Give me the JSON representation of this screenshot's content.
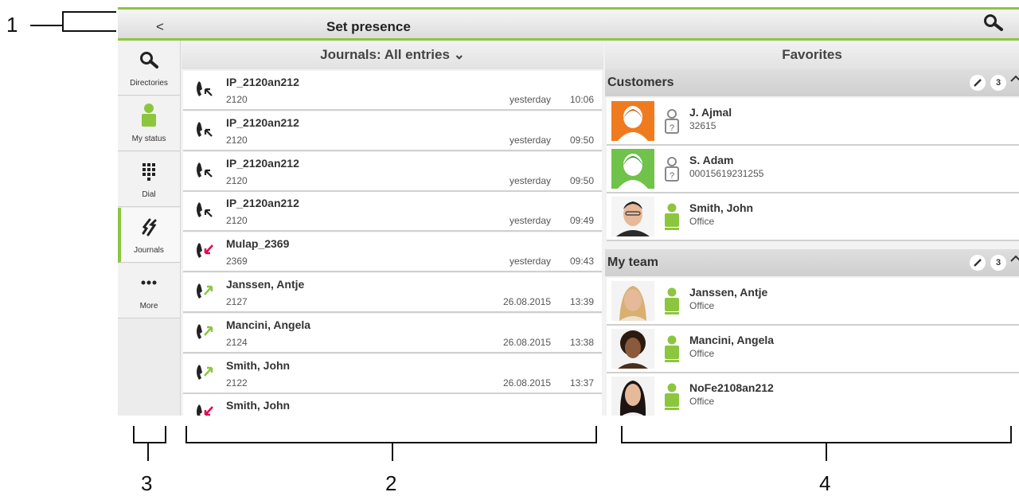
{
  "callouts": [
    "1",
    "2",
    "3",
    "4"
  ],
  "topbar": {
    "back_label": "<",
    "title": "Set presence"
  },
  "nav": [
    {
      "label": "Directories",
      "icon": "search-icon"
    },
    {
      "label": "My status",
      "icon": "person-status-icon"
    },
    {
      "label": "Dial",
      "icon": "dialpad-icon"
    },
    {
      "label": "Journals",
      "icon": "journals-icon",
      "active": true
    },
    {
      "label": "More",
      "icon": "more-dots-icon"
    }
  ],
  "journals": {
    "header": "Journals: All entries ⌄",
    "entries": [
      {
        "name": "IP_2120an212",
        "number": "2120",
        "day": "yesterday",
        "time": "10:06",
        "type": "missed"
      },
      {
        "name": "IP_2120an212",
        "number": "2120",
        "day": "yesterday",
        "time": "09:50",
        "type": "missed"
      },
      {
        "name": "IP_2120an212",
        "number": "2120",
        "day": "yesterday",
        "time": "09:50",
        "type": "missed"
      },
      {
        "name": "IP_2120an212",
        "number": "2120",
        "day": "yesterday",
        "time": "09:49",
        "type": "missed"
      },
      {
        "name": "Mulap_2369",
        "number": "2369",
        "day": "yesterday",
        "time": "09:43",
        "type": "incoming"
      },
      {
        "name": "Janssen, Antje",
        "number": "2127",
        "day": "26.08.2015",
        "time": "13:39",
        "type": "outgoing"
      },
      {
        "name": "Mancini, Angela",
        "number": "2124",
        "day": "26.08.2015",
        "time": "13:38",
        "type": "outgoing"
      },
      {
        "name": "Smith, John",
        "number": "2122",
        "day": "26.08.2015",
        "time": "13:37",
        "type": "outgoing"
      },
      {
        "name": "Smith, John",
        "number": "",
        "day": "",
        "time": "",
        "type": "incoming"
      }
    ]
  },
  "favorites": {
    "header": "Favorites",
    "groups": [
      {
        "title": "Customers",
        "count": "3",
        "contacts": [
          {
            "name": "J. Ajmal",
            "sub": "32615",
            "avatar": "orange-placeholder",
            "presence": "unknown"
          },
          {
            "name": "S. Adam",
            "sub": "00015619231255",
            "avatar": "green-placeholder",
            "presence": "unknown"
          },
          {
            "name": "Smith, John",
            "sub": "Office",
            "avatar": "photo-man",
            "presence": "available"
          }
        ]
      },
      {
        "title": "My team",
        "count": "3",
        "contacts": [
          {
            "name": "Janssen, Antje",
            "sub": "Office",
            "avatar": "photo-woman-blonde",
            "presence": "available"
          },
          {
            "name": "Mancini, Angela",
            "sub": "Office",
            "avatar": "photo-woman-curly",
            "presence": "available"
          },
          {
            "name": "NoFe2108an212",
            "sub": "Office",
            "avatar": "photo-woman-dark",
            "presence": "available"
          }
        ]
      }
    ]
  },
  "colors": {
    "accent_green": "#8cc63f",
    "missed_red": "#e5004a",
    "bg": "#f2f2f2"
  }
}
